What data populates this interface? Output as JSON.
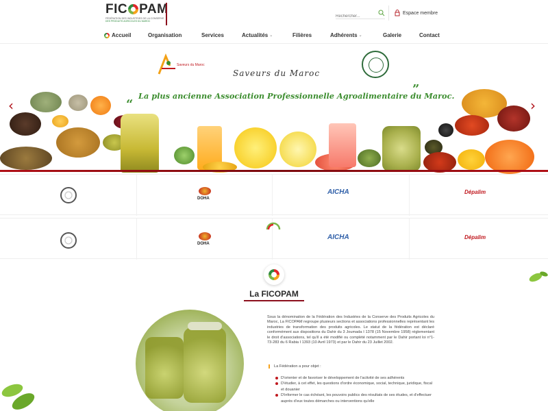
{
  "brand": {
    "logo_prefix": "FIC",
    "logo_suffix": "PAM",
    "subtitle_line1": "FÉDÉRATION DES INDUSTRIES DE LA CONSERVE",
    "subtitle_line2": "DES PRODUITS AGRICOLES DU MAROC"
  },
  "header": {
    "search_placeholder": "Rechercher...",
    "member_label": "Espace membre"
  },
  "nav": {
    "items": [
      {
        "label": "Accueil"
      },
      {
        "label": "Organisation"
      },
      {
        "label": "Services"
      },
      {
        "label": "Actualités",
        "chevron": "⌄"
      },
      {
        "label": "Filières"
      },
      {
        "label": "Adhérents",
        "chevron": "⌄"
      },
      {
        "label": "Galerie"
      },
      {
        "label": "Contact"
      }
    ]
  },
  "hero": {
    "saveurs_label": "Saveurs du Maroc",
    "script_title": "Saveurs du Maroc",
    "slogan": "La plus ancienne Association Professionnelle Agroalimentaire du Maroc.",
    "quote_open": "“",
    "quote_close": "”",
    "prev_arrow": "‹",
    "next_arrow": "›"
  },
  "partners": {
    "row1": [
      {
        "name": ""
      },
      {
        "name": "DOHA"
      },
      {
        "name": "AICHA"
      },
      {
        "name": "Dépalim"
      }
    ],
    "row2": [
      {
        "name": ""
      },
      {
        "name": "DOHA"
      },
      {
        "name": "AICHA"
      },
      {
        "name": "Dépalim"
      }
    ]
  },
  "about": {
    "title": "La FICOPAM",
    "paragraph": "Sous la dénomination de la Fédération des Industries de la Conserve des Produits Agricoles du Maroc, La FICOPAM regroupe plusieurs sections et associations professionnelles représentant les industries de transformation des produits agricoles. Le statut de la fédération est déclaré conformément aux dispositions du Dahir du 3 Joumada I 1378 (15 Novembre 1958) réglementant le droit d'associations, tel qu'il a été modifié ou complété notamment par le Dahir portant loi n°1-73-283 du 6 Rabia I 1393 (10 Avril 1973) et par le Dahir du 23 Juillet 2002.",
    "objective_label": "La Fédération a pour objet :",
    "objectives": [
      "D'orienter et de favoriser le développement de l'activité de ses adhérents",
      "D'étudier, à cet effet, les questions d'ordre économique, social, technique, juridique, fiscal et douanier",
      "D'informer le cas échéant, les pouvoirs publics des résultats de ses études, et d'effectuer auprès d'eux toutes démarches ou interventions qu'elle"
    ]
  },
  "colors": {
    "accent_red": "#8b0e1c",
    "slogan_green": "#3c8d2f",
    "arrow_red": "#b01018"
  }
}
